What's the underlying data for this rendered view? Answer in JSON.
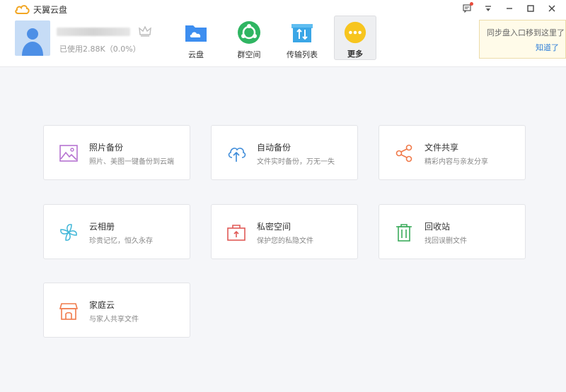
{
  "app": {
    "title": "天翼云盘"
  },
  "account": {
    "usage": "已使用2.88K（0.0%）"
  },
  "nav": [
    {
      "label": "云盘",
      "icon": "cloud-folder-icon",
      "color": "#3d8ef0"
    },
    {
      "label": "群空间",
      "icon": "group-space-icon",
      "color": "#2fb562"
    },
    {
      "label": "传输列表",
      "icon": "transfer-list-icon",
      "color": "#3aa6e6"
    },
    {
      "label": "更多",
      "icon": "more-icon",
      "color": "#f7c51f",
      "active": true
    }
  ],
  "tooltip": {
    "text": "同步盘入口移到这里了",
    "link": "知道了"
  },
  "cards": [
    {
      "title": "照片备份",
      "desc": "照片、美图一键备份到云端",
      "icon": "photo-icon",
      "color": "#b673d1"
    },
    {
      "title": "自动备份",
      "desc": "文件实时备份，万无一失",
      "icon": "cloud-upload-icon",
      "color": "#3b8ad9"
    },
    {
      "title": "文件共享",
      "desc": "精彩内容与亲友分享",
      "icon": "share-icon",
      "color": "#f07a4a"
    },
    {
      "title": "云相册",
      "desc": "珍贵记忆，恒久永存",
      "icon": "pinwheel-icon",
      "color": "#3fb6d8"
    },
    {
      "title": "私密空间",
      "desc": "保护您的私隐文件",
      "icon": "safe-box-icon",
      "color": "#e05a57"
    },
    {
      "title": "回收站",
      "desc": "找回误删文件",
      "icon": "trash-icon",
      "color": "#3bab5b"
    },
    {
      "title": "家庭云",
      "desc": "与家人共享文件",
      "icon": "home-cloud-icon",
      "color": "#f07a4a"
    }
  ]
}
